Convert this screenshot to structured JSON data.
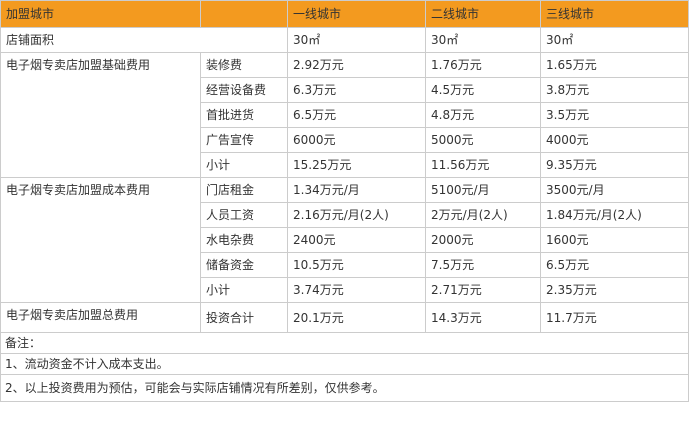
{
  "headers": [
    "加盟城市",
    "",
    "一线城市",
    "二线城市",
    "三线城市"
  ],
  "store_area": {
    "label": "店铺面积",
    "values": [
      "30㎡",
      "30㎡",
      "30㎡"
    ]
  },
  "basic_fee": {
    "group": "电子烟专卖店加盟基础费用",
    "rows": [
      {
        "item": "装修费",
        "values": [
          "2.92万元",
          "1.76万元",
          "1.65万元"
        ]
      },
      {
        "item": "经营设备费",
        "values": [
          "6.3万元",
          "4.5万元",
          "3.8万元"
        ]
      },
      {
        "item": "首批进货",
        "values": [
          "6.5万元",
          "4.8万元",
          "3.5万元"
        ]
      },
      {
        "item": "广告宣传",
        "values": [
          "6000元",
          "5000元",
          "4000元"
        ]
      },
      {
        "item": "小计",
        "values": [
          "15.25万元",
          "11.56万元",
          "9.35万元"
        ]
      }
    ]
  },
  "cost_fee": {
    "group": "电子烟专卖店加盟成本费用",
    "rows": [
      {
        "item": "门店租金",
        "values": [
          "1.34万元/月",
          "5100元/月",
          "3500元/月"
        ]
      },
      {
        "item": "人员工资",
        "values": [
          "2.16万元/月(2人)",
          "2万元/月(2人)",
          "1.84万元/月(2人)"
        ]
      },
      {
        "item": "水电杂费",
        "values": [
          "2400元",
          "2000元",
          "1600元"
        ]
      },
      {
        "item": "储备资金",
        "values": [
          "10.5万元",
          "7.5万元",
          "6.5万元"
        ]
      },
      {
        "item": "小计",
        "values": [
          "3.74万元",
          "2.71万元",
          "2.35万元"
        ]
      }
    ]
  },
  "total_fee": {
    "group": "电子烟专卖店加盟总费用",
    "item": "投资合计",
    "values": [
      "20.1万元",
      "14.3万元",
      "11.7万元"
    ]
  },
  "notes": {
    "title": "备注：",
    "lines": [
      "1、流动资金不计入成本支出。",
      "2、以上投资费用为预估，可能会与实际店铺情况有所差别，仅供参考。"
    ]
  },
  "colors": {
    "header_bg": "#f39a1f",
    "border": "#cccccc",
    "text": "#333333"
  }
}
